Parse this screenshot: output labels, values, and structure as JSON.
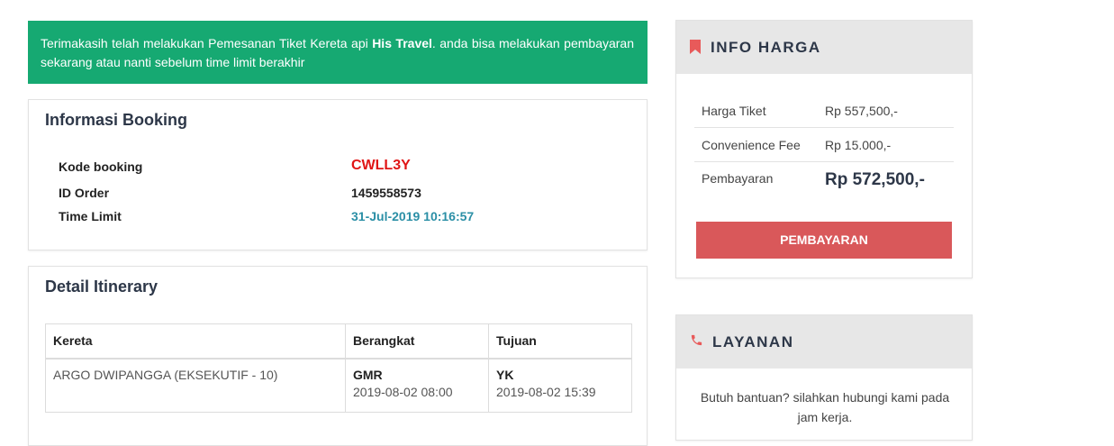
{
  "alert": {
    "text_before": "Terimakasih telah melakukan Pemesanan Tiket Kereta api ",
    "brand": "His Travel",
    "text_after": ". anda bisa melakukan pembayaran sekarang atau nanti sebelum time limit berakhir"
  },
  "booking": {
    "title": "Informasi Booking",
    "rows": [
      {
        "label": "Kode booking",
        "value": "CWLL3Y"
      },
      {
        "label": "ID Order",
        "value": "1459558573"
      },
      {
        "label": "Time Limit",
        "value": "31-Jul-2019 10:16:57"
      }
    ]
  },
  "itinerary": {
    "title": "Detail Itinerary",
    "headers": [
      "Kereta",
      "Berangkat",
      "Tujuan"
    ],
    "row": {
      "train": "ARGO DWIPANGGA (EKSEKUTIF - 10)",
      "depart_code": "GMR",
      "depart_time": "2019-08-02 08:00",
      "arrive_code": "YK",
      "arrive_time": "2019-08-02 15:39"
    }
  },
  "info_harga": {
    "title": "INFO HARGA",
    "icon": "bookmark-icon",
    "rows": [
      {
        "label": "Harga Tiket",
        "value": "Rp 557,500,-"
      },
      {
        "label": "Convenience Fee",
        "value": "Rp 15.000,-"
      },
      {
        "label": "Pembayaran",
        "value": "Rp 572,500,-"
      }
    ],
    "button": "PEMBAYARAN"
  },
  "layanan": {
    "title": "LAYANAN",
    "icon": "phone-icon",
    "text": "Butuh bantuan? silahkan hubungi kami pada jam kerja."
  },
  "colors": {
    "alert_green": "#16a972",
    "code_red": "#e01616",
    "time_teal": "#2b8fa6",
    "button_red": "#d9585a",
    "icon_red": "#e85a5a"
  }
}
